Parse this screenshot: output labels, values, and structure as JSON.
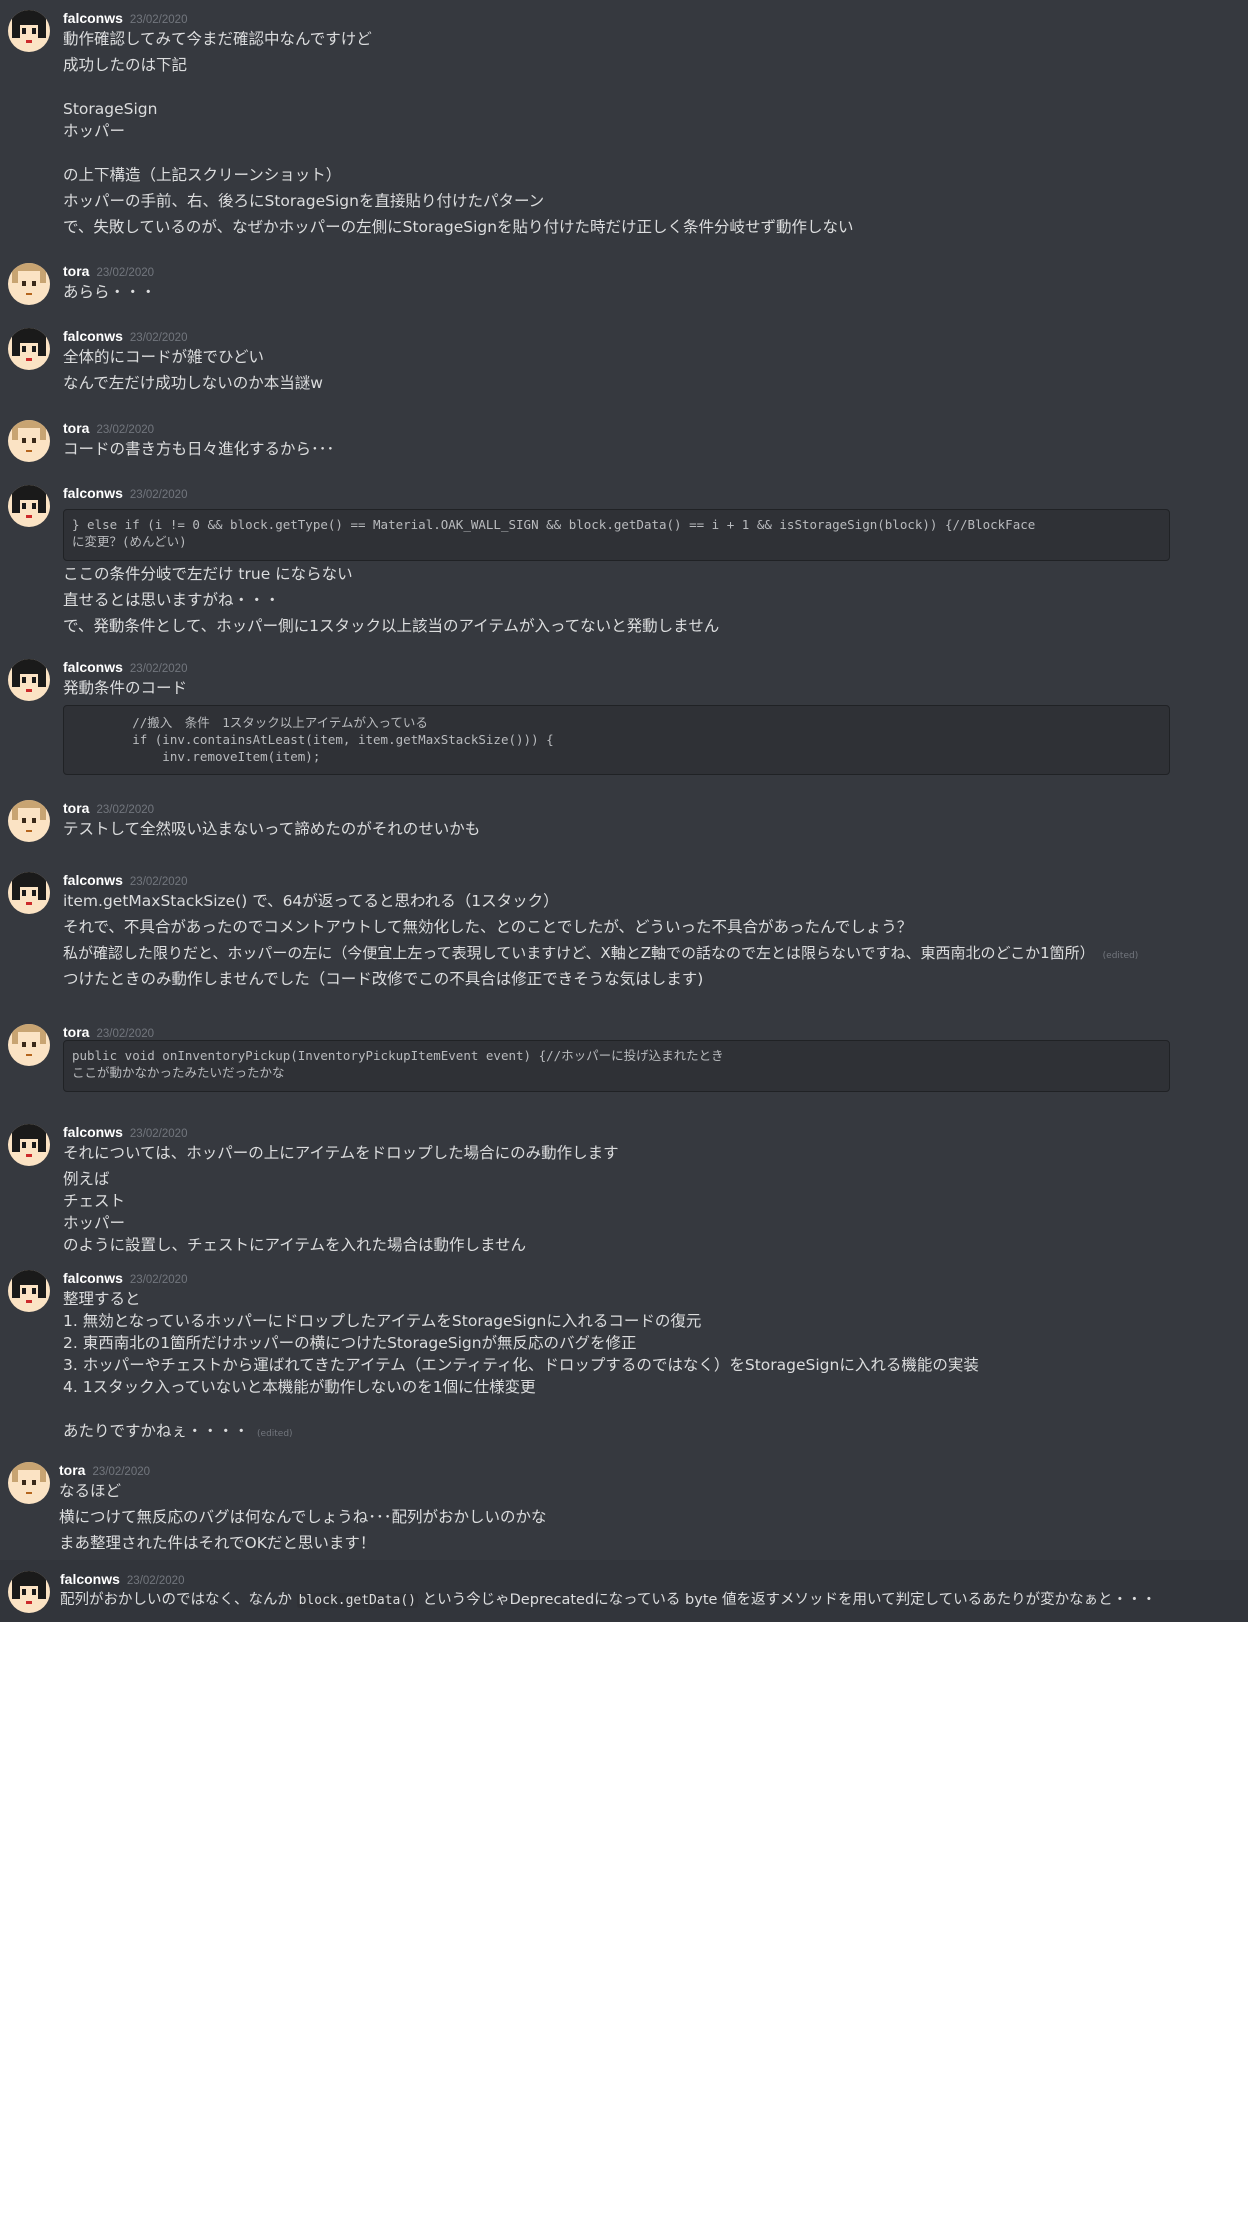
{
  "users": {
    "falconws": "falconws",
    "tora": "tora"
  },
  "date": "23/02/2020",
  "edited_label": "(edited)",
  "messages": {
    "m1": {
      "lines": [
        "動作確認してみて今まだ確認中なんですけど",
        "成功したのは下記",
        "StorageSign",
        "ホッパー",
        "の上下構造（上記スクリーンショット）",
        "ホッパーの手前、右、後ろにStorageSignを直接貼り付けたパターン",
        "で、失敗しているのが、なぜかホッパーの左側にStorageSignを貼り付けた時だけ正しく条件分岐せず動作しない"
      ]
    },
    "m2": {
      "lines": [
        "あらら・・・"
      ]
    },
    "m3": {
      "lines": [
        "全体的にコードが雑でひどい",
        "なんで左だけ成功しないのか本当謎w"
      ]
    },
    "m4": {
      "lines": [
        "コードの書き方も日々進化するから･･･"
      ]
    },
    "m5": {
      "code": [
        "} else if (i != 0 && block.getType() == Material.OAK_WALL_SIGN && block.getData() == i + 1 && isStorageSign(block)) {//BlockFace",
        "に変更？(めんどい)"
      ],
      "lines": [
        "ここの条件分岐で左だけ true にならない",
        "直せるとは思いますがね・・・",
        "で、発動条件として、ホッパー側に1スタック以上該当のアイテムが入ってないと発動しません"
      ]
    },
    "m6": {
      "lines": [
        "発動条件のコード"
      ],
      "code": [
        "        //搬入　条件　1スタック以上アイテムが入っている",
        "        if (inv.containsAtLeast(item, item.getMaxStackSize())) {",
        "            inv.removeItem(item);"
      ]
    },
    "m7": {
      "lines": [
        "テストして全然吸い込まないって諦めたのがそれのせいかも"
      ]
    },
    "m8": {
      "lines": [
        "item.getMaxStackSize() で、64が返ってると思われる（1スタック）",
        "それで、不具合があったのでコメントアウトして無効化した、とのことでしたが、どういった不具合があったんでしょう？",
        "私が確認した限りだと、ホッパーの左に（今便宜上左って表現していますけど、X軸とZ軸での話なので左とは限らないですね、東西南北のどこか1箇所）",
        "つけたときのみ動作しませんでした（コード改修でこの不具合は修正できそうな気はします)"
      ]
    },
    "m9": {
      "code": [
        "public void onInventoryPickup(InventoryPickupItemEvent event) {//ホッパーに投げ込まれたとき",
        "ここが動かなかったみたいだったかな"
      ]
    },
    "m10": {
      "lines": [
        "それについては、ホッパーの上にアイテムをドロップした場合にのみ動作します",
        "例えば",
        "チェスト",
        "ホッパー",
        "のように設置し、チェストにアイテムを入れた場合は動作しません"
      ]
    },
    "m11": {
      "lines": [
        "整理すると",
        "1. 無効となっているホッパーにドロップしたアイテムをStorageSignに入れるコードの復元",
        "2. 東西南北の1箇所だけホッパーの横につけたStorageSignが無反応のバグを修正",
        "3. ホッパーやチェストから運ばれてきたアイテム（エンティティ化、ドロップするのではなく）をStorageSignに入れる機能の実装",
        "4. 1スタック入っていないと本機能が動作しないのを1個に仕様変更",
        "あたりですかねぇ・・・・"
      ]
    },
    "m12": {
      "lines": [
        "なるほど",
        "横につけて無反応のバグは何なんでしょうね･･･配列がおかしいのかな",
        "まあ整理された件はそれでOKだと思います！"
      ]
    },
    "m13": {
      "pre": "配列がおかしいのではなく、なんか ",
      "code": "block.getData()",
      "post": " という今じゃDeprecatedになっている byte 値を返すメソッドを用いて判定しているあたりが変かなぁと・・・"
    }
  },
  "colors": {
    "background": "#36393f",
    "code_background": "#2f3136",
    "username": "#ffffff",
    "text": "#dcddde",
    "timestamp": "#72767d"
  }
}
